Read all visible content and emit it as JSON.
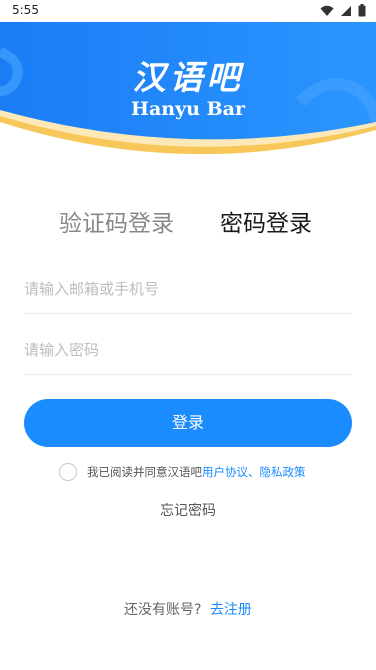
{
  "status_bar": {
    "time": "5:55",
    "icons": [
      "wifi-icon",
      "signal-icon",
      "battery-icon"
    ]
  },
  "brand": {
    "name_cn": "汉语吧",
    "name_en": "Hanyu Bar"
  },
  "tabs": [
    {
      "label": "验证码登录",
      "active": false
    },
    {
      "label": "密码登录",
      "active": true
    }
  ],
  "form": {
    "account_placeholder": "请输入邮箱或手机号",
    "account_value": "",
    "password_placeholder": "请输入密码",
    "password_value": ""
  },
  "login_button": {
    "label": "登录"
  },
  "agreement": {
    "checked": false,
    "prefix": "我已阅读并同意汉语吧",
    "user_agreement": "用户协议",
    "separator": "、",
    "privacy_policy": "隐私政策"
  },
  "forgot_password": "忘记密码",
  "register": {
    "prompt": "还没有账号?",
    "link": "去注册"
  },
  "colors": {
    "primary": "#1a8cff",
    "hero_blue": "#1f86ff",
    "hero_accent": "#f5c542"
  }
}
